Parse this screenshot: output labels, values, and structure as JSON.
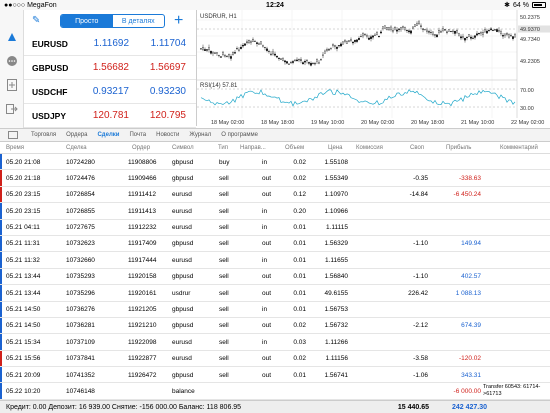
{
  "status": {
    "carrier": "●●○○○ MegaFon",
    "time": "12:24",
    "battery": "64 %"
  },
  "quotes": {
    "tab_simple": "Просто",
    "tab_detailed": "В деталях",
    "rows": [
      {
        "symbol": "EURUSD",
        "bid": "1.11692",
        "ask": "1.11704",
        "color": "blue"
      },
      {
        "symbol": "GBPUSD",
        "bid": "1.56682",
        "ask": "1.56697",
        "color": "red"
      },
      {
        "symbol": "USDCHF",
        "bid": "0.93217",
        "ask": "0.93230",
        "color": "blue"
      },
      {
        "symbol": "USDJPY",
        "bid": "120.781",
        "ask": "120.795",
        "color": "red"
      }
    ]
  },
  "chart": {
    "title": "USDRUR, H1",
    "indicator": "RSI(14) 57.81",
    "price_labels": [
      "50.2375",
      "49.9370",
      "49.7340",
      "49.2305"
    ],
    "price_tag": "49.9370",
    "rsi_labels": [
      "70.00",
      "30.00"
    ],
    "time_labels": [
      "18 May 02:00",
      "18 May 18:00",
      "19 May 10:00",
      "20 May 02:00",
      "20 May 18:00",
      "21 May 10:00",
      "22 May 02:00"
    ]
  },
  "toolbar": {
    "tabs": [
      "Торговля",
      "Ордера",
      "Сделки",
      "Почта",
      "Новости",
      "Журнал",
      "О программе"
    ],
    "active_tab": "Сделки"
  },
  "table": {
    "headers": {
      "time": "Время",
      "deal": "Сделка",
      "order": "Ордер",
      "symbol": "Символ",
      "type": "Тип",
      "direction": "Направ...",
      "volume": "Объем",
      "price": "Цена",
      "commission": "Комиссия",
      "swap": "Своп",
      "profit": "Прибыль",
      "comment": "Комментарий"
    },
    "rows": [
      {
        "time": "05.20 21:08",
        "deal": "10724280",
        "order": "11908806",
        "symbol": "gbpusd",
        "type": "buy",
        "dir": "in",
        "vol": "0.02",
        "price": "1.55108",
        "swap": "",
        "profit": "",
        "pcolor": "",
        "mark": "#1b62d0"
      },
      {
        "time": "05.20 21:18",
        "deal": "10724476",
        "order": "11909466",
        "symbol": "gbpusd",
        "type": "sell",
        "dir": "out",
        "vol": "0.02",
        "price": "1.55349",
        "swap": "-0.35",
        "profit": "-338.63",
        "pcolor": "red",
        "mark": "#d0211b"
      },
      {
        "time": "05.20 23:15",
        "deal": "10726854",
        "order": "11911412",
        "symbol": "eurusd",
        "type": "sell",
        "dir": "out",
        "vol": "0.12",
        "price": "1.10970",
        "swap": "-14.84",
        "profit": "-6 450.24",
        "pcolor": "red",
        "mark": "#d0211b"
      },
      {
        "time": "05.20 23:15",
        "deal": "10726855",
        "order": "11911413",
        "symbol": "eurusd",
        "type": "sell",
        "dir": "in",
        "vol": "0.20",
        "price": "1.10966",
        "swap": "",
        "profit": "",
        "pcolor": "",
        "mark": "#1b62d0"
      },
      {
        "time": "05.21 04:11",
        "deal": "10727675",
        "order": "11912232",
        "symbol": "eurusd",
        "type": "sell",
        "dir": "in",
        "vol": "0.01",
        "price": "1.11115",
        "swap": "",
        "profit": "",
        "pcolor": "",
        "mark": "#1b62d0"
      },
      {
        "time": "05.21 11:31",
        "deal": "10732623",
        "order": "11917409",
        "symbol": "gbpusd",
        "type": "sell",
        "dir": "out",
        "vol": "0.01",
        "price": "1.56329",
        "swap": "-1.10",
        "profit": "149.94",
        "pcolor": "blue",
        "mark": "#1b62d0"
      },
      {
        "time": "05.21 11:32",
        "deal": "10732660",
        "order": "11917444",
        "symbol": "eurusd",
        "type": "sell",
        "dir": "in",
        "vol": "0.01",
        "price": "1.11655",
        "swap": "",
        "profit": "",
        "pcolor": "",
        "mark": "#1b62d0"
      },
      {
        "time": "05.21 13:44",
        "deal": "10735293",
        "order": "11920158",
        "symbol": "gbpusd",
        "type": "sell",
        "dir": "out",
        "vol": "0.01",
        "price": "1.56840",
        "swap": "-1.10",
        "profit": "402.57",
        "pcolor": "blue",
        "mark": "#1b62d0"
      },
      {
        "time": "05.21 13:44",
        "deal": "10735296",
        "order": "11920161",
        "symbol": "usdrur",
        "type": "sell",
        "dir": "out",
        "vol": "0.01",
        "price": "49.6155",
        "swap": "226.42",
        "profit": "1 088.13",
        "pcolor": "blue",
        "mark": "#1b62d0"
      },
      {
        "time": "05.21 14:50",
        "deal": "10736276",
        "order": "11921205",
        "symbol": "gbpusd",
        "type": "sell",
        "dir": "in",
        "vol": "0.01",
        "price": "1.56753",
        "swap": "",
        "profit": "",
        "pcolor": "",
        "mark": "#1b62d0"
      },
      {
        "time": "05.21 14:50",
        "deal": "10736281",
        "order": "11921210",
        "symbol": "gbpusd",
        "type": "sell",
        "dir": "out",
        "vol": "0.02",
        "price": "1.56732",
        "swap": "-2.12",
        "profit": "674.39",
        "pcolor": "blue",
        "mark": "#1b62d0"
      },
      {
        "time": "05.21 15:34",
        "deal": "10737109",
        "order": "11922098",
        "symbol": "eurusd",
        "type": "sell",
        "dir": "in",
        "vol": "0.03",
        "price": "1.11266",
        "swap": "",
        "profit": "",
        "pcolor": "",
        "mark": "#1b62d0"
      },
      {
        "time": "05.21 15:56",
        "deal": "10737841",
        "order": "11922877",
        "symbol": "eurusd",
        "type": "sell",
        "dir": "out",
        "vol": "0.02",
        "price": "1.11156",
        "swap": "-3.58",
        "profit": "-120.02",
        "pcolor": "red",
        "mark": "#d0211b"
      },
      {
        "time": "05.21 20:09",
        "deal": "10741352",
        "order": "11926472",
        "symbol": "gbpusd",
        "type": "sell",
        "dir": "out",
        "vol": "0.01",
        "price": "1.56741",
        "swap": "-1.06",
        "profit": "343.31",
        "pcolor": "blue",
        "mark": "#1b62d0"
      },
      {
        "time": "05.22 10:20",
        "deal": "10746148",
        "order": "",
        "symbol": "balance",
        "type": "",
        "dir": "",
        "vol": "",
        "price": "",
        "swap": "",
        "profit": "-6 000.00",
        "pcolor": "red",
        "comment": "Transfer 60543: 61714->61713",
        "mark": "#1b62d0"
      }
    ]
  },
  "footer": {
    "summary": "Кредит: 0.00 Депозит: 16 939.00 Снятие: -156 000.00 Баланс: 118 806.95",
    "swap_total": "15 440.65",
    "profit_total": "242 427.30"
  }
}
